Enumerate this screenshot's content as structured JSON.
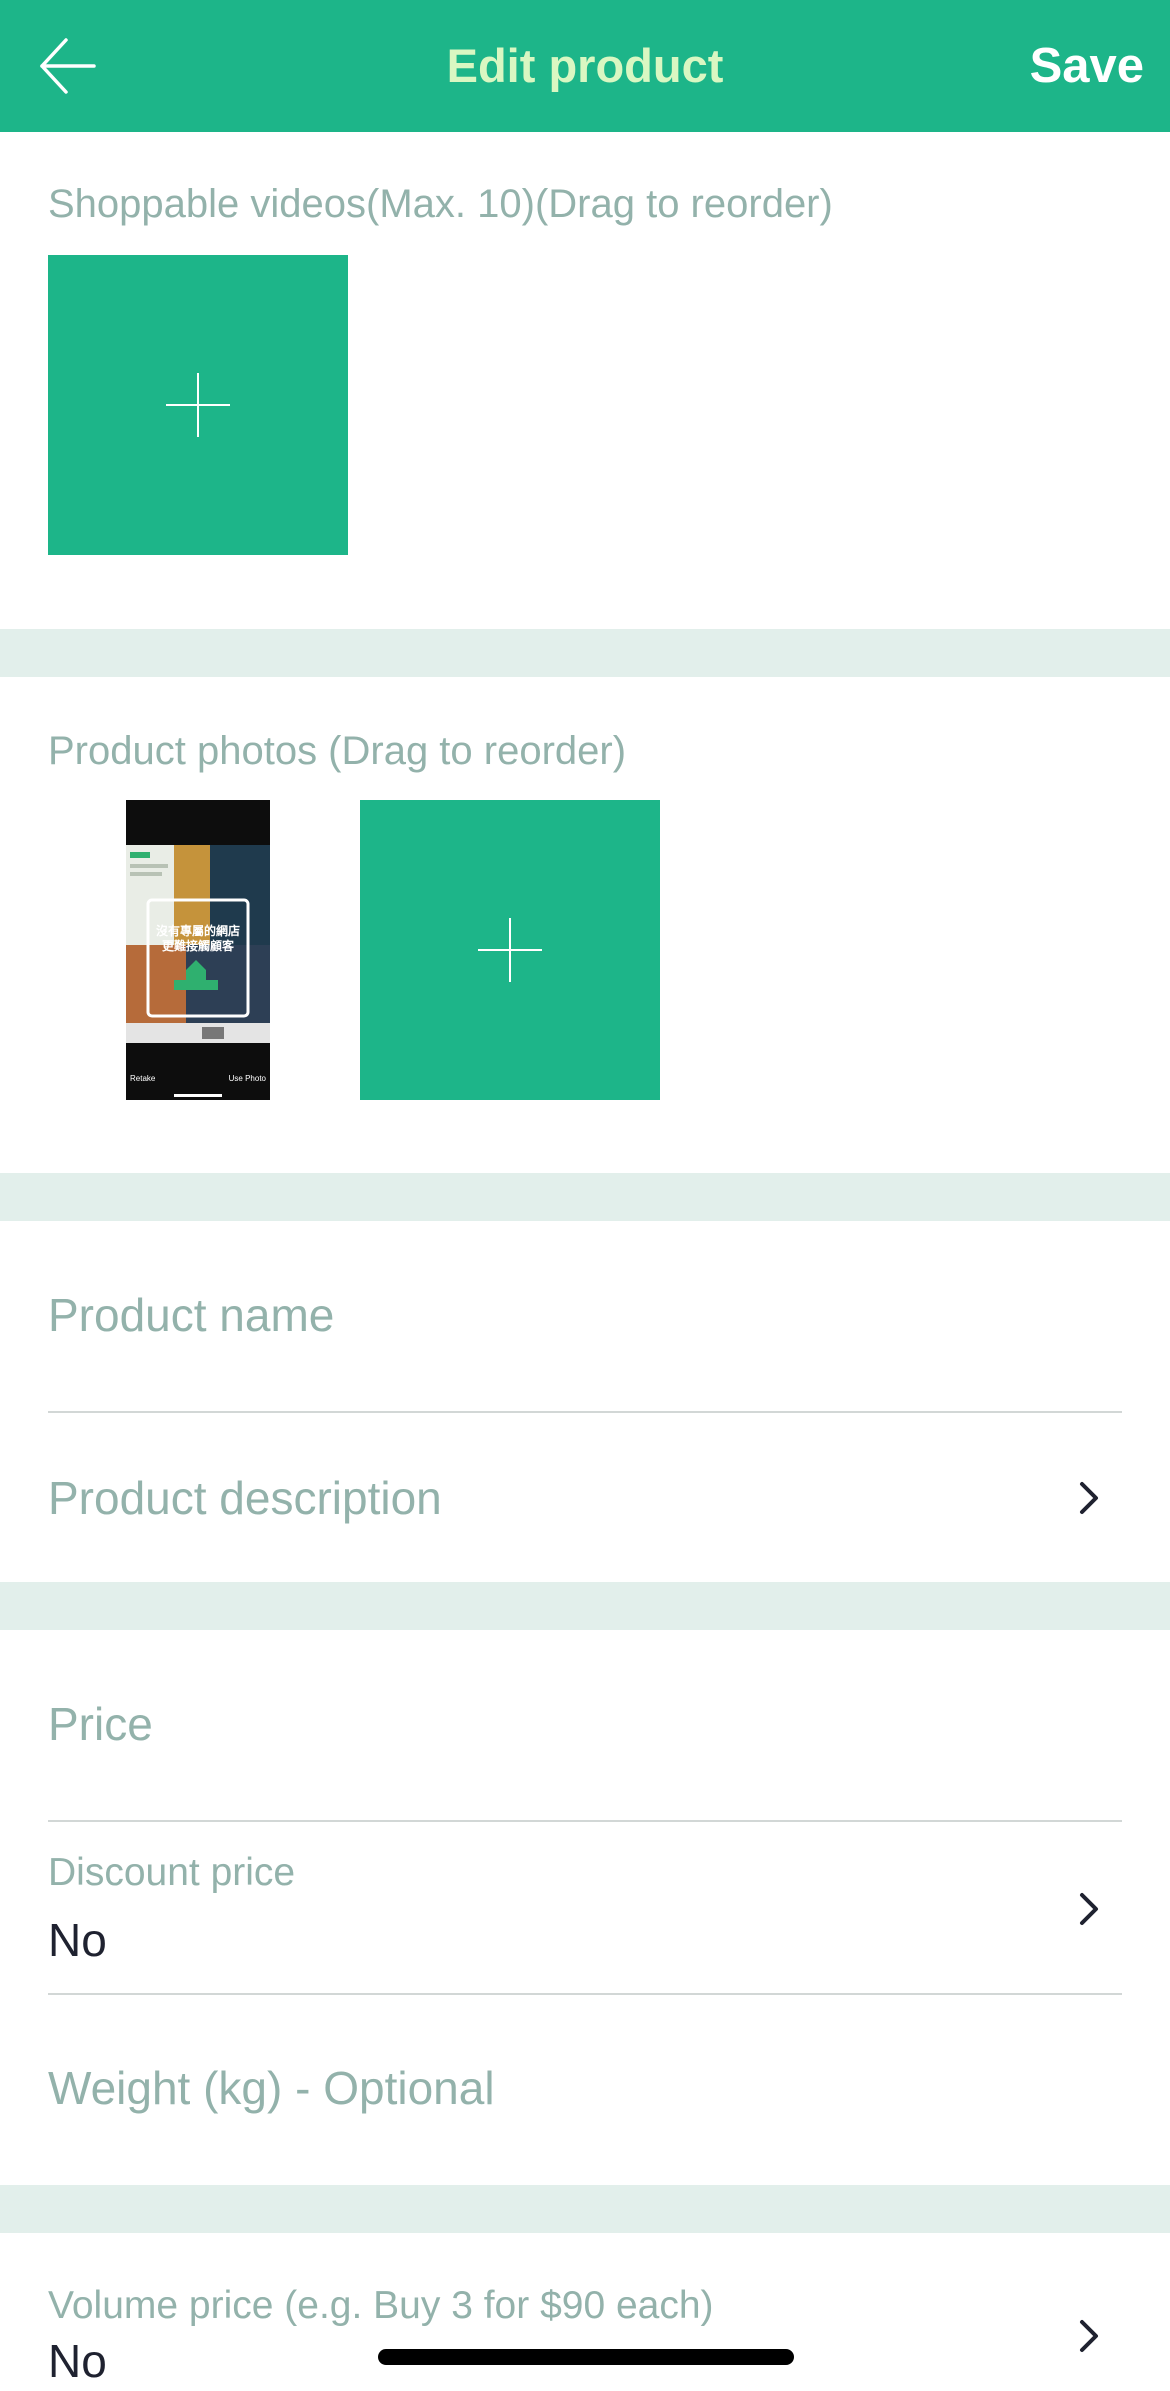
{
  "header": {
    "title": "Edit product",
    "save_label": "Save",
    "back_icon": "arrow-left-icon"
  },
  "videos": {
    "label": "Shoppable videos(Max. 10)(Drag to reorder)",
    "add_icon": "plus-icon"
  },
  "photos": {
    "label": "Product photos (Drag to reorder)",
    "thumbnail": {
      "caption_line1": "沒有專屬的網店",
      "caption_line2": "更難接觸顧客",
      "retake_label": "Retake",
      "use_photo_label": "Use Photo"
    },
    "add_icon": "plus-icon"
  },
  "fields": {
    "product_name_placeholder": "Product name",
    "product_description_placeholder": "Product description",
    "price_placeholder": "Price",
    "discount_price_label": "Discount price",
    "discount_price_value": "No",
    "weight_placeholder": "Weight (kg) - Optional",
    "volume_price_label": "Volume price (e.g. Buy 3 for $90 each)",
    "volume_price_value": "No"
  },
  "colors": {
    "brand_green": "#1db589",
    "title_text": "#d9f7c2",
    "muted_text": "#93b2ab",
    "band": "#e2efeb"
  }
}
